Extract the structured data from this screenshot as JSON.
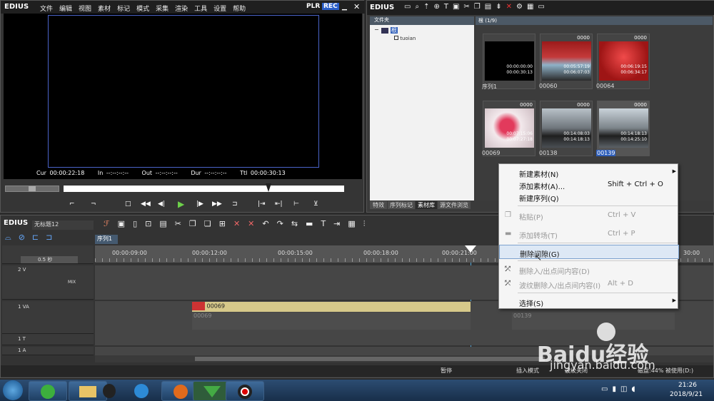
{
  "player": {
    "brand": "EDIUS",
    "menu": [
      "文件",
      "编辑",
      "视图",
      "素材",
      "标记",
      "模式",
      "采集",
      "渲染",
      "工具",
      "设置",
      "帮助"
    ],
    "plr": "PLR",
    "rec": "REC",
    "cur": "Cur 00:00:22:18",
    "in": "In --:--:--:--",
    "out": "Out --:--:--:--",
    "dur": "Dur --:--:--:--",
    "ttl": "Ttl 00:00:30:13"
  },
  "bin": {
    "brand": "EDIUS",
    "folder_label": "文件夹",
    "tree_root": "根",
    "tree_child": "tuoian",
    "path_label": "根 (1/9)",
    "clips": [
      {
        "name": "序列1",
        "num": "",
        "tc1": "00:00:00:00",
        "tc2": "00:00:30:13"
      },
      {
        "name": "00060",
        "num": "0000",
        "tc1": "00:05:57:19",
        "tc2": "00:06:07:03"
      },
      {
        "name": "00064",
        "num": "0000",
        "tc1": "00:06:19:15",
        "tc2": "00:06:34:17"
      },
      {
        "name": "00069",
        "num": "0000",
        "tc1": "00:07:15:06",
        "tc2": "00:07:27:18"
      },
      {
        "name": "00138",
        "num": "0000",
        "tc1": "00:14:08:03",
        "tc2": "00:14:18:13"
      },
      {
        "name": "00139",
        "num": "0000",
        "tc1": "00:14:18:13",
        "tc2": "00:14:25:10"
      }
    ],
    "tabs": [
      "特效",
      "序列标记",
      "素材库",
      "源文件浏览"
    ]
  },
  "context_menu": {
    "items": [
      {
        "label": "新建素材(N)",
        "key": ""
      },
      {
        "label": "添加素材(A)...",
        "key": "Shift + Ctrl + O"
      },
      {
        "label": "新建序列(Q)",
        "key": ""
      },
      {
        "label": "粘贴(P)",
        "key": "Ctrl + V"
      },
      {
        "label": "添加转场(T)",
        "key": "Ctrl + P"
      },
      {
        "label": "删除间隙(G)",
        "key": ""
      },
      {
        "label": "删除入/出点间内容(D)",
        "key": ""
      },
      {
        "label": "波纹删除入/出点间内容(I)",
        "key": "Alt + D"
      },
      {
        "label": "选择(S)",
        "key": ""
      }
    ]
  },
  "timeline": {
    "brand": "EDIUS",
    "project": "无标题12",
    "seq_tab": "序列1",
    "zoom": "0.5 秒",
    "ruler": [
      "00:00:09:00",
      "00:00:12:00",
      "00:00:15:00",
      "00:00:18:00",
      "00:00:21:00",
      "30:00"
    ],
    "tracks": {
      "v2": "2 V",
      "mix": "MIX",
      "va1": "1 VA",
      "t1": "1 T",
      "a1": "1 A"
    },
    "clip1": {
      "name": "00069",
      "sub": "00069"
    },
    "clip2": {
      "sub": "00139"
    }
  },
  "status": {
    "pause": "暂停",
    "insert": "插入模式",
    "wave": "波纹关闭",
    "disk": "磁盘:44% 被使用(D:)"
  },
  "taskbar": {
    "time": "21:26",
    "date": "2018/9/21"
  },
  "watermark": {
    "text": "Baidu经验",
    "url": "jingyan.baidu.com"
  }
}
